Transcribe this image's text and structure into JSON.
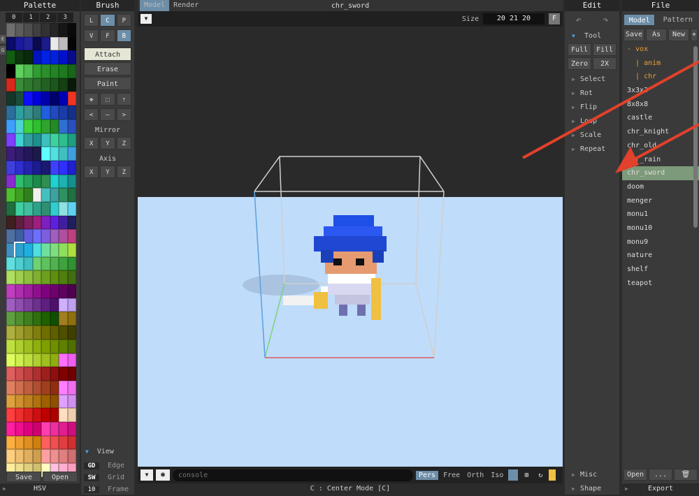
{
  "palette": {
    "title": "Palette",
    "cols": [
      "0",
      "1",
      "2",
      "3"
    ],
    "side_labels": [
      "E",
      "G"
    ],
    "save": "Save",
    "open": "Open",
    "mode": "HSV",
    "colors": [
      "#6f6f6f",
      "#5c5c5c",
      "#4e4e4e",
      "#3f3f3f",
      "#323232",
      "#262626",
      "#161616",
      "#0a0a0a",
      "#0b0b6a",
      "#1a1a9c",
      "#23239c",
      "#0a0a50",
      "#1b1b8a",
      "#e9e9e9",
      "#bcbcbc",
      "#050505",
      "#135c13",
      "#0e350e",
      "#0a2a0a",
      "#0015bf",
      "#0022e6",
      "#0022dd",
      "#0011cc",
      "#0a0a8c",
      "#000000",
      "#5fd25f",
      "#4fbd4f",
      "#2f9d2f",
      "#2b8e2b",
      "#228522",
      "#1e7a1e",
      "#186618",
      "#d9291c",
      "#3a8b3a",
      "#2f7a2f",
      "#2b6f2b",
      "#236123",
      "#1c561c",
      "#144014",
      "#0a1a0a",
      "#15372a",
      "#1a4c3a",
      "#0f0fff",
      "#0000dd",
      "#0000aa",
      "#00006e",
      "#0000b3",
      "#ef3424",
      "#2b6f9c",
      "#2fa0a0",
      "#3a8f8f",
      "#2f7a7a",
      "#1f5fe0",
      "#2349bf",
      "#1a3ca8",
      "#15308a",
      "#3f9fff",
      "#4fd2d2",
      "#3fd23f",
      "#2fbf2f",
      "#2fa32f",
      "#248a24",
      "#2f6fd2",
      "#2b4fbf",
      "#7f3fff",
      "#3fd2d2",
      "#2f9f9f",
      "#1f8f8f",
      "#3fbfbf",
      "#3fd2a0",
      "#2fbf8f",
      "#1f9f7f",
      "#3d1c7a",
      "#2f1c6a",
      "#24185a",
      "#1c1a4a",
      "#5fffff",
      "#50e0e0",
      "#40c0c0",
      "#3fa0e0",
      "#3f3fe0",
      "#2f2fd0",
      "#2424b0",
      "#1c1c90",
      "#1a1a70",
      "#3f3fff",
      "#2f2fff",
      "#2020d0",
      "#8a2bd2",
      "#2fbf6f",
      "#25a35a",
      "#1c8a4a",
      "#2f8f4f",
      "#1fd2d2",
      "#1fb0b0",
      "#158f8f",
      "#4fbf2f",
      "#3fa024",
      "#2f801c",
      "#f0f0f0",
      "#45c0c0",
      "#3fa0a0",
      "#2f9060",
      "#207040",
      "#1f6f3f",
      "#40d0a0",
      "#3fbf9f",
      "#2fa08a",
      "#2f8f6f",
      "#2fcfcf",
      "#8fe0e0",
      "#5fd2f2",
      "#3f1f1f",
      "#5f1f3f",
      "#7f1f5f",
      "#9f1f7f",
      "#7f1fbf",
      "#5f1fdf",
      "#3f1f9f",
      "#1f1f5f",
      "#4f6fa0",
      "#3f5f9f",
      "#5f5fdf",
      "#6f6fff",
      "#7f5fdf",
      "#9f5fbf",
      "#af4f9f",
      "#bf3f7f",
      "#3f8fbf",
      "#2fa0d0",
      "#1fb0e0",
      "#4fdfdf",
      "#6fdf9f",
      "#7fdf7f",
      "#8fdf5f",
      "#afdf3f",
      "#5fdfdf",
      "#4fcfcf",
      "#3fbfbf",
      "#6fd26f",
      "#5fc25f",
      "#4fb24f",
      "#3fa23f",
      "#2f922f",
      "#afdf5f",
      "#9fcf4f",
      "#8fbf3f",
      "#7faf2f",
      "#6f9f1f",
      "#5f8f0f",
      "#4f7f0f",
      "#3f6f0f",
      "#bf3fbf",
      "#af2faf",
      "#9f1f9f",
      "#8f0f8f",
      "#7f007f",
      "#6f006f",
      "#5f005f",
      "#4f004f",
      "#9f5fbf",
      "#8f4faf",
      "#7f3f9f",
      "#6f2f8f",
      "#5f1f7f",
      "#4f0f6f",
      "#cfafff",
      "#bf9fef",
      "#5f9f3f",
      "#4f8f2f",
      "#3f7f1f",
      "#2f6f0f",
      "#1f5f00",
      "#0f4f00",
      "#9f7f1f",
      "#8f6f0f",
      "#afaf3f",
      "#9f9f2f",
      "#8f8f1f",
      "#7f7f0f",
      "#6f6f00",
      "#5f5f00",
      "#4f4f00",
      "#3f3f00",
      "#bfdf3f",
      "#afcf2f",
      "#9fbf1f",
      "#8faf0f",
      "#7f9f00",
      "#6f8f00",
      "#5f7f00",
      "#4f6f00",
      "#dfff5f",
      "#cfef4f",
      "#bfdf3f",
      "#afcf2f",
      "#9fbf1f",
      "#8faf0f",
      "#ff6fff",
      "#ef5fef",
      "#df5f5f",
      "#cf4f4f",
      "#bf3f3f",
      "#af2f2f",
      "#9f1f1f",
      "#8f0f0f",
      "#7f0000",
      "#6f0000",
      "#df7f5f",
      "#cf6f4f",
      "#bf5f3f",
      "#af4f2f",
      "#9f3f1f",
      "#8f2f0f",
      "#ff7fff",
      "#ef6fef",
      "#dfa03f",
      "#cf902f",
      "#bf801f",
      "#af700f",
      "#9f6000",
      "#8f5000",
      "#dfa0ff",
      "#cf90ef",
      "#ff3f3f",
      "#ef2f2f",
      "#df1f1f",
      "#cf0f0f",
      "#bf0000",
      "#af0000",
      "#ffdfbf",
      "#efcfaf",
      "#ff1f9f",
      "#ef0f8f",
      "#df007f",
      "#cf006f",
      "#ff3faf",
      "#ef2f9f",
      "#df1f8f",
      "#cf0f7f",
      "#ffaf3f",
      "#ef9f2f",
      "#df8f1f",
      "#cf7f0f",
      "#ff5f5f",
      "#ef4f4f",
      "#df3f3f",
      "#cf2f2f",
      "#ffcf7f",
      "#efbf6f",
      "#dfaf5f",
      "#cf9f4f",
      "#ff9f9f",
      "#ef8f8f",
      "#df7f7f",
      "#cf6f6f",
      "#ffef9f",
      "#efdf8f",
      "#dfcf7f",
      "#cfbf6f",
      "#ffffbf",
      "#ffbfdf",
      "#ffafcf",
      "#ff9fbf"
    ]
  },
  "brush": {
    "title": "Brush",
    "row1": [
      "L",
      "C",
      "P"
    ],
    "row2": [
      "V",
      "F",
      "B"
    ],
    "attach": "Attach",
    "erase": "Erase",
    "paint": "Paint",
    "move_icons": [
      "move-icon",
      "select-icon",
      "extrude-icon"
    ],
    "nav": [
      "<",
      "—",
      ">"
    ],
    "mirror": "Mirror",
    "mirror_axes": [
      "X",
      "Y",
      "Z"
    ],
    "axis": "Axis",
    "axis_axes": [
      "X",
      "Y",
      "Z"
    ],
    "view": "View",
    "view_rows": [
      {
        "key": "GD",
        "label": "Edge"
      },
      {
        "key": "SW",
        "label": "Grid"
      },
      {
        "key": "10",
        "label": "Frame"
      }
    ]
  },
  "center": {
    "tab_model": "Model",
    "tab_render": "Render",
    "title": "chr_sword",
    "size_label": "Size",
    "size_value": "20 21 20",
    "size_btn": "F",
    "console_placeholder": "console",
    "view_modes": [
      "Pers",
      "Free",
      "Orth",
      "Iso"
    ],
    "status": "C : Center Mode [C]"
  },
  "edit": {
    "title": "Edit",
    "tool_label": "Tool",
    "tool_buttons": [
      "Full",
      "Fill",
      "Zero",
      "2X"
    ],
    "items": [
      "Select",
      "Rot",
      "Flip",
      "Loop",
      "Scale",
      "Repeat"
    ],
    "bottom_items": [
      "Misc",
      "Shape"
    ]
  },
  "file": {
    "title": "File",
    "tab_model": "Model",
    "tab_pattern": "Pattern",
    "actions": [
      "Save",
      "As",
      "New",
      "+"
    ],
    "entries": [
      {
        "label": "- vox",
        "orange": true,
        "selected": false
      },
      {
        "label": "  | anim",
        "orange": true,
        "selected": false
      },
      {
        "label": "  | chr",
        "orange": true,
        "selected": false
      },
      {
        "label": "3x3x3",
        "orange": false,
        "selected": false
      },
      {
        "label": "8x8x8",
        "orange": false,
        "selected": false
      },
      {
        "label": "castle",
        "orange": false,
        "selected": false
      },
      {
        "label": "chr_knight",
        "orange": false,
        "selected": false
      },
      {
        "label": "chr_old",
        "orange": false,
        "selected": false
      },
      {
        "label": "chr_rain",
        "orange": false,
        "selected": false
      },
      {
        "label": "chr_sword",
        "orange": false,
        "selected": true
      },
      {
        "label": "doom",
        "orange": false,
        "selected": false
      },
      {
        "label": "menger",
        "orange": false,
        "selected": false
      },
      {
        "label": "monu1",
        "orange": false,
        "selected": false
      },
      {
        "label": "monu10",
        "orange": false,
        "selected": false
      },
      {
        "label": "monu9",
        "orange": false,
        "selected": false
      },
      {
        "label": "nature",
        "orange": false,
        "selected": false
      },
      {
        "label": "shelf",
        "orange": false,
        "selected": false
      },
      {
        "label": "teapot",
        "orange": false,
        "selected": false
      }
    ],
    "open": "Open",
    "more": "...",
    "export": "Export"
  }
}
